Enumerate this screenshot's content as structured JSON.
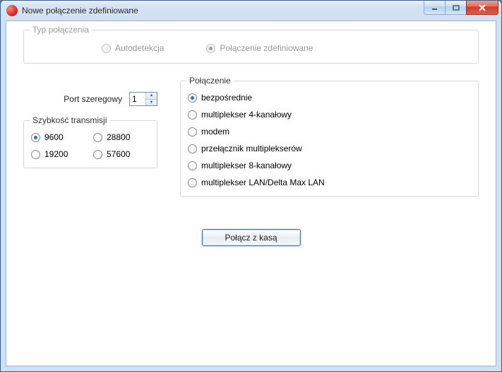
{
  "window": {
    "title": "Nowe połączenie zdefiniowane"
  },
  "type_group": {
    "legend": "Typ połączenia",
    "autodetect_label": "Autodetekcja",
    "defined_label": "Połączenie zdefiniowane",
    "selected": "defined"
  },
  "port": {
    "label": "Port szeregowy",
    "value": "1"
  },
  "speed": {
    "legend": "Szybkość transmisji",
    "options": [
      "9600",
      "28800",
      "19200",
      "57600"
    ],
    "selected": "9600"
  },
  "connection": {
    "legend": "Połączenie",
    "options": [
      "bezpośrednie",
      "multiplekser 4-kanałowy",
      "modem",
      "przełącznik multiplekserów",
      "multiplekser 8-kanałowy",
      "multiplekser LAN/Delta Max LAN"
    ],
    "selected": "bezpośrednie"
  },
  "connect_button_label": "Połącz z kasą"
}
